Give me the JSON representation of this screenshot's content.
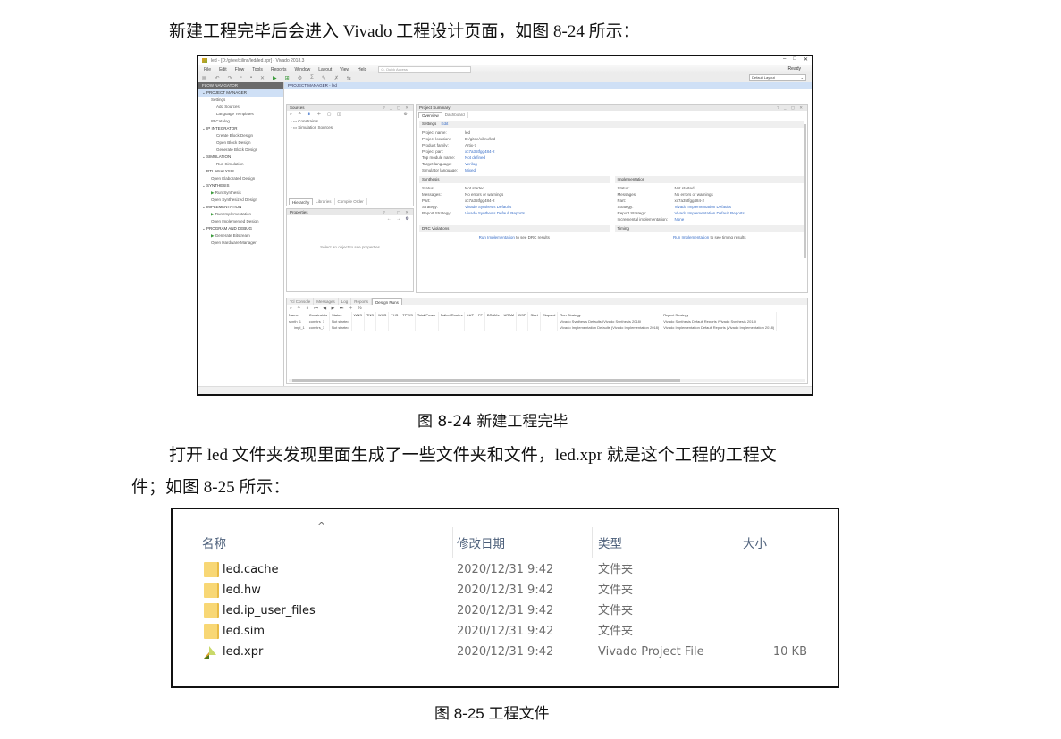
{
  "text": {
    "intro": "新建工程完毕后会进入 Vivado 工程设计页面，如图 8-24 所示：",
    "fig1_caption": "图 8-24  新建工程完毕",
    "para2_line1": "打开  led  文件夹发现里面生成了一些文件夹和文件，led.xpr 就是这个工程的工程文",
    "para2_line2": "件；如图 8-25 所示：",
    "fig2_caption": "图 8-25   工程文件"
  },
  "vivado": {
    "title": "led - [D:/gitee/xilinx/led/led.xpr] - Vivado 2018.3",
    "menu": [
      "File",
      "Edit",
      "Flow",
      "Tools",
      "Reports",
      "Window",
      "Layout",
      "View",
      "Help"
    ],
    "quick_access": "Q- Quick Access",
    "status": "Ready",
    "layout_select": "Default Layout",
    "flow_nav_title": "FLOW NAVIGATOR",
    "flow_nav": [
      {
        "label": "PROJECT MANAGER",
        "level": "sec",
        "selected": true
      },
      {
        "label": "Settings",
        "level": "sub"
      },
      {
        "label": "Add Sources",
        "level": "subsub"
      },
      {
        "label": "Language Templates",
        "level": "subsub"
      },
      {
        "label": "IP Catalog",
        "level": "sub"
      },
      {
        "label": "IP INTEGRATOR",
        "level": "sec"
      },
      {
        "label": "Create Block Design",
        "level": "subsub"
      },
      {
        "label": "Open Block Design",
        "level": "subsub"
      },
      {
        "label": "Generate Block Design",
        "level": "subsub"
      },
      {
        "label": "SIMULATION",
        "level": "sec"
      },
      {
        "label": "Run Simulation",
        "level": "subsub"
      },
      {
        "label": "RTL ANALYSIS",
        "level": "sec"
      },
      {
        "label": "Open Elaborated Design",
        "level": "sub"
      },
      {
        "label": "SYNTHESIS",
        "level": "sec"
      },
      {
        "label": "Run Synthesis",
        "level": "sub",
        "play": true
      },
      {
        "label": "Open Synthesized Design",
        "level": "sub"
      },
      {
        "label": "IMPLEMENTATION",
        "level": "sec"
      },
      {
        "label": "Run Implementation",
        "level": "sub",
        "play": true
      },
      {
        "label": "Open Implemented Design",
        "level": "sub"
      },
      {
        "label": "PROGRAM AND DEBUG",
        "level": "sec"
      },
      {
        "label": "Generate Bitstream",
        "level": "sub",
        "play": true
      },
      {
        "label": "Open Hardware Manager",
        "level": "sub"
      }
    ],
    "pm_bar": "PROJECT MANAGER - led",
    "sources": {
      "title": "Sources",
      "unsaved": "Hierarchy",
      "items": [
        "Constraints",
        "Simulation Sources"
      ],
      "tabs": [
        "Hierarchy",
        "Libraries",
        "Compile Order"
      ]
    },
    "properties": {
      "title": "Properties",
      "empty": "Select an object to see properties"
    },
    "summary": {
      "title": "Project Summary",
      "tabs": [
        "Overview",
        "Dashboard"
      ],
      "settings_label": "Settings",
      "edit_label": "Edit",
      "settings": [
        {
          "k": "Project name:",
          "v": "led",
          "link": false
        },
        {
          "k": "Project location:",
          "v": "D:/gitee/xilinx/led",
          "link": false
        },
        {
          "k": "Product family:",
          "v": "Artix-7",
          "link": false
        },
        {
          "k": "Project part:",
          "v": "xc7a35tfgg484-2",
          "link": true
        },
        {
          "k": "Top module name:",
          "v": "Not defined",
          "link": true
        },
        {
          "k": "Target language:",
          "v": "Verilog",
          "link": true
        },
        {
          "k": "Simulator language:",
          "v": "Mixed",
          "link": true
        }
      ],
      "synthesis": {
        "title": "Synthesis",
        "rows": [
          {
            "k": "Status:",
            "v": "Not started",
            "link": false
          },
          {
            "k": "Messages:",
            "v": "No errors or warnings",
            "link": false
          },
          {
            "k": "Part:",
            "v": "xc7a35tfgg484-2",
            "link": false
          },
          {
            "k": "Strategy:",
            "v": "Vivado Synthesis Defaults",
            "link": true
          },
          {
            "k": "Report Strategy:",
            "v": "Vivado Synthesis Default Reports",
            "link": true
          }
        ]
      },
      "implementation": {
        "title": "Implementation",
        "rows": [
          {
            "k": "Status:",
            "v": "Not started",
            "link": false
          },
          {
            "k": "Messages:",
            "v": "No errors or warnings",
            "link": false
          },
          {
            "k": "Part:",
            "v": "xc7a35tfgg484-2",
            "link": false
          },
          {
            "k": "Strategy:",
            "v": "Vivado Implementation Defaults",
            "link": true
          },
          {
            "k": "Report Strategy:",
            "v": "Vivado Implementation Default Reports",
            "link": true
          },
          {
            "k": "Incremental implementation:",
            "v": "None",
            "link": true
          }
        ]
      },
      "drc": {
        "title": "DRC Violations",
        "link": "Run Implementation",
        "text": "to see DRC results"
      },
      "timing": {
        "title": "Timing",
        "link": "Run Implementation",
        "text": "to see timing results"
      }
    },
    "bottom": {
      "tabs": [
        "Tcl Console",
        "Messages",
        "Log",
        "Reports",
        "Design Runs"
      ],
      "active_tab": "Design Runs",
      "columns": [
        "Name",
        "Constraints",
        "Status",
        "WNS",
        "TNS",
        "WHS",
        "THS",
        "TPWS",
        "Total Power",
        "Failed Routes",
        "LUT",
        "FF",
        "BRAMs",
        "URAM",
        "DSP",
        "Start",
        "Elapsed",
        "Run Strategy",
        "Report Strategy"
      ],
      "rows": [
        [
          "synth_1",
          "constrs_1",
          "Not started",
          "",
          "",
          "",
          "",
          "",
          "",
          "",
          "",
          "",
          "",
          "",
          "",
          "",
          "",
          "Vivado Synthesis Defaults (Vivado Synthesis 2018)",
          "Vivado Synthesis Default Reports (Vivado Synthesis 2018)"
        ],
        [
          "impl_1",
          "constrs_1",
          "Not started",
          "",
          "",
          "",
          "",
          "",
          "",
          "",
          "",
          "",
          "",
          "",
          "",
          "",
          "",
          "Vivado Implementation Defaults (Vivado Implementation 2018)",
          "Vivado Implementation Default Reports (Vivado Implementation 2018)"
        ]
      ]
    }
  },
  "explorer": {
    "columns": [
      "名称",
      "修改日期",
      "类型",
      "大小"
    ],
    "files": [
      {
        "name": "led.cache",
        "date": "2020/12/31 9:42",
        "type": "文件夹",
        "size": "",
        "icon": "folder-icon"
      },
      {
        "name": "led.hw",
        "date": "2020/12/31 9:42",
        "type": "文件夹",
        "size": "",
        "icon": "folder-icon"
      },
      {
        "name": "led.ip_user_files",
        "date": "2020/12/31 9:42",
        "type": "文件夹",
        "size": "",
        "icon": "folder-icon"
      },
      {
        "name": "led.sim",
        "date": "2020/12/31 9:42",
        "type": "文件夹",
        "size": "",
        "icon": "folder-icon"
      },
      {
        "name": "led.xpr",
        "date": "2020/12/31 9:42",
        "type": "Vivado Project File",
        "size": "10 KB",
        "icon": "vivado-project-icon"
      }
    ]
  }
}
